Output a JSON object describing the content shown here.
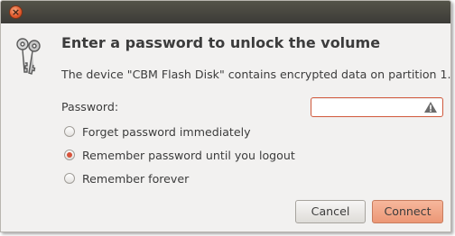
{
  "window": {
    "close_glyph": "×"
  },
  "dialog": {
    "icon": "keys-icon",
    "heading": "Enter a password to unlock the volume",
    "description": "The device \"CBM Flash Disk\" contains encrypted data on partition 1.",
    "password_label": "Password:",
    "password_value": "",
    "password_state_icon": "warning-icon"
  },
  "options": [
    {
      "label": "Forget password immediately",
      "checked": false
    },
    {
      "label": "Remember password until you logout",
      "checked": true
    },
    {
      "label": "Remember forever",
      "checked": false
    }
  ],
  "buttons": {
    "cancel": "Cancel",
    "connect": "Connect"
  },
  "colors": {
    "accent": "#e0562a",
    "titlebar": "#3c3b37",
    "background": "#f2f1f0",
    "error_border": "#d15a3d"
  }
}
